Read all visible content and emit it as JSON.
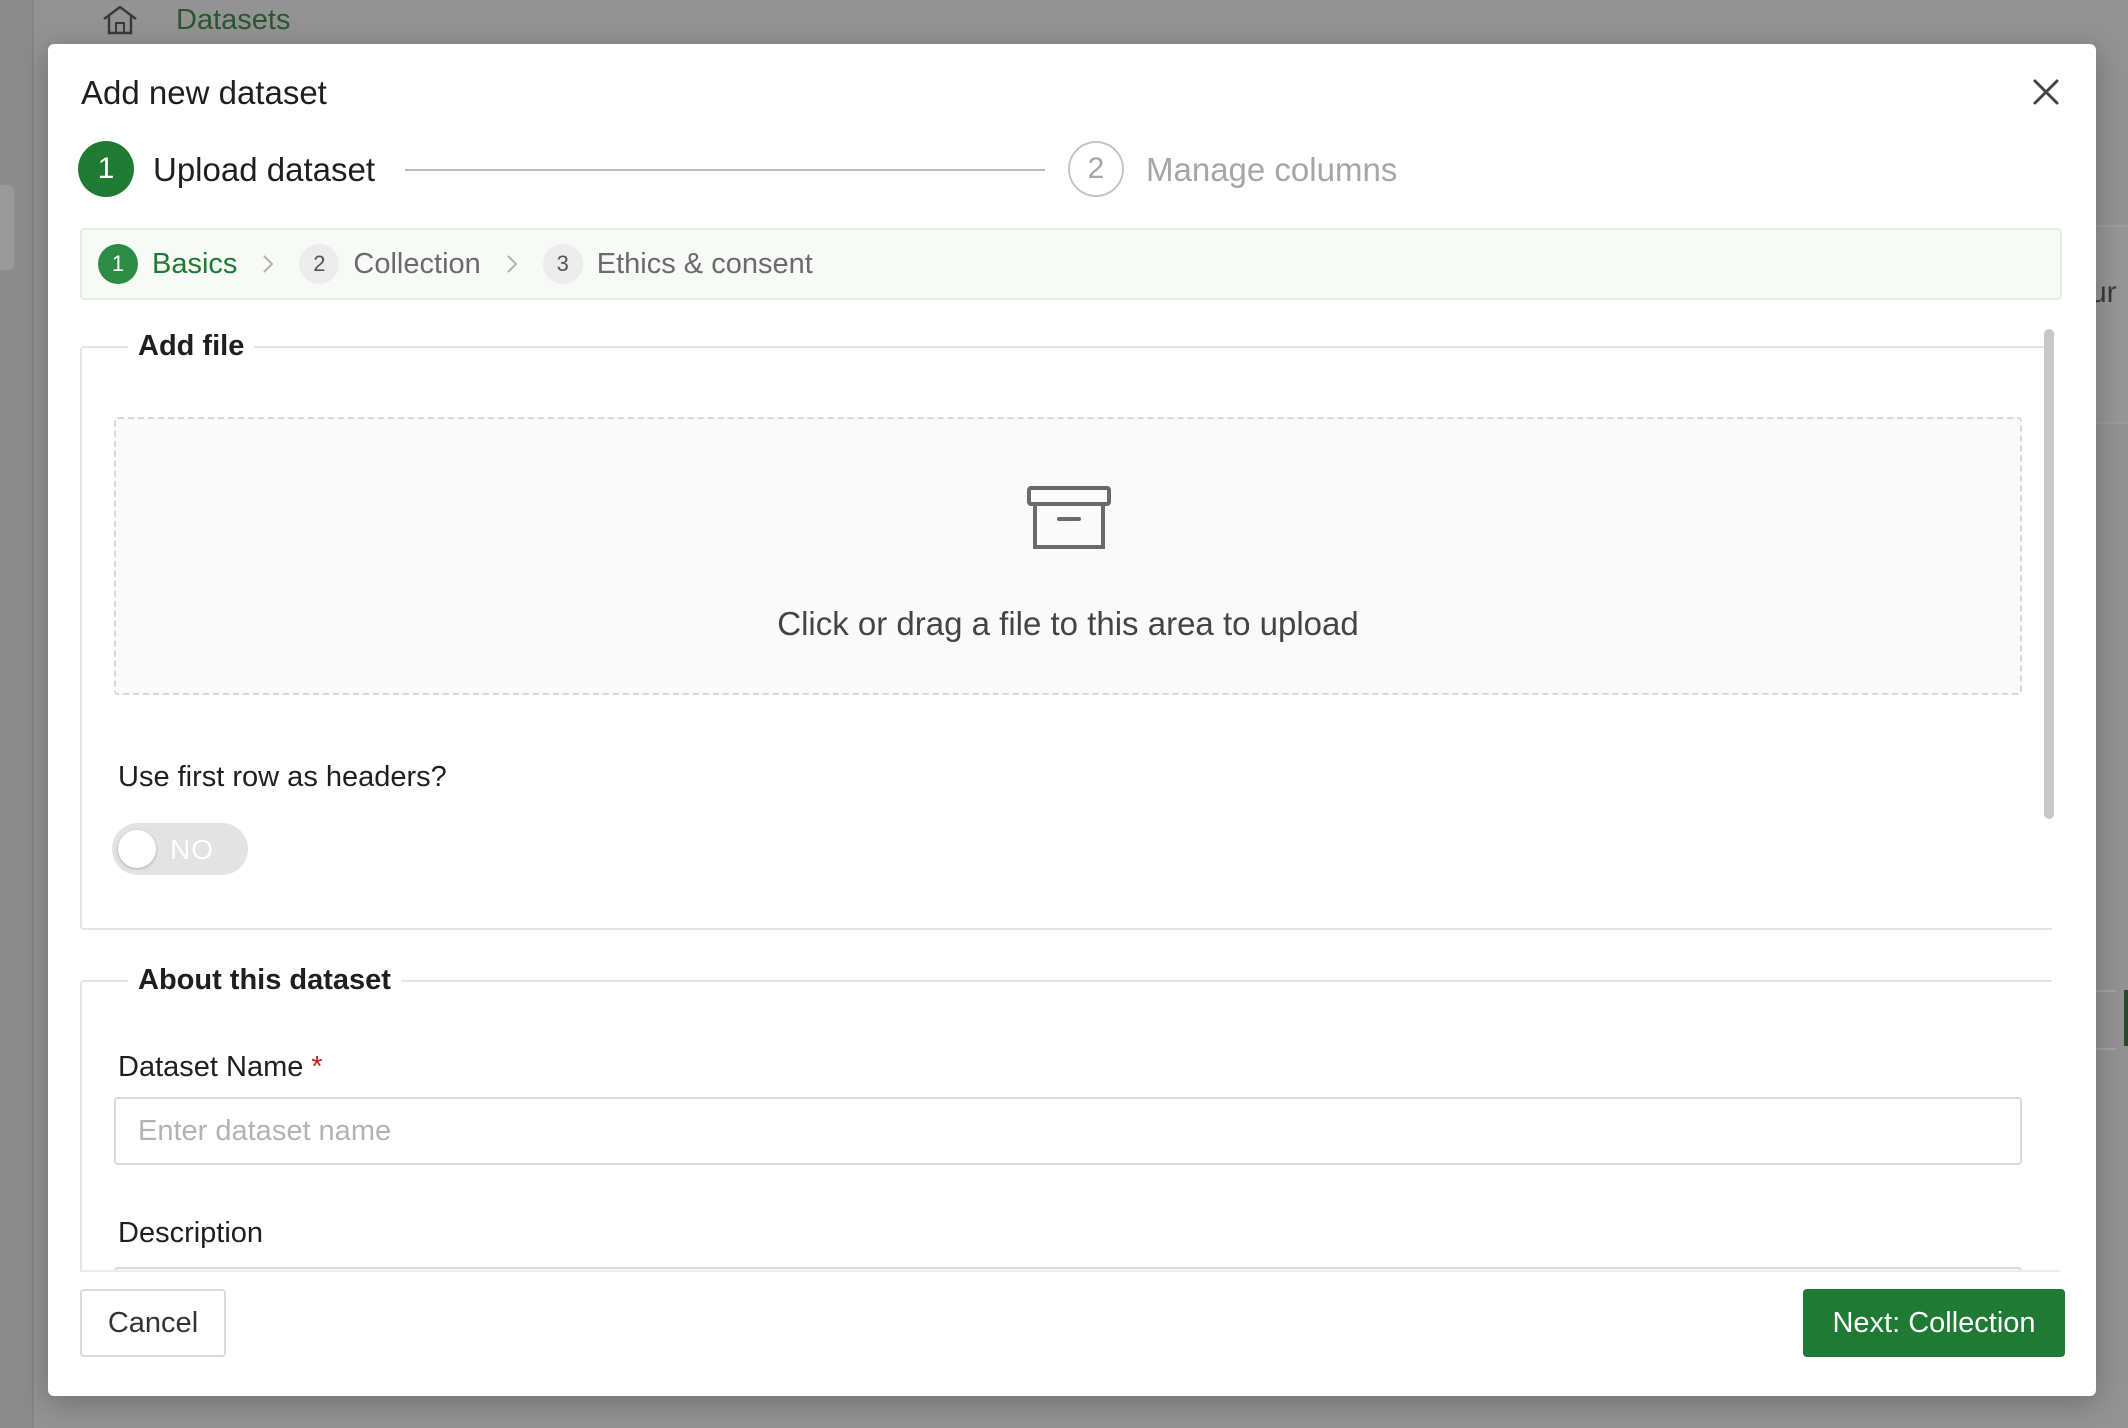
{
  "background": {
    "breadcrumb_label": "Datasets",
    "right_fragment_text": "ur"
  },
  "modal": {
    "title": "Add new dataset",
    "main_steps": [
      {
        "number": "1",
        "label": "Upload dataset",
        "state": "active"
      },
      {
        "number": "2",
        "label": "Manage columns",
        "state": "inactive"
      }
    ],
    "sub_steps": [
      {
        "number": "1",
        "label": "Basics",
        "state": "active"
      },
      {
        "number": "2",
        "label": "Collection",
        "state": "inactive"
      },
      {
        "number": "3",
        "label": "Ethics & consent",
        "state": "inactive"
      }
    ],
    "add_file": {
      "legend": "Add file",
      "upload_text": "Click or drag a file to this area to upload",
      "headers_question": "Use first row as headers?",
      "toggle_value": "NO"
    },
    "about": {
      "legend": "About this dataset",
      "name_label": "Dataset Name",
      "required_mark": "*",
      "name_placeholder": "Enter dataset name",
      "name_value": "",
      "description_label": "Description"
    },
    "footer": {
      "cancel_label": "Cancel",
      "next_label": "Next: Collection"
    }
  },
  "colors": {
    "primary_green": "#1f7a34",
    "active_sub_green": "#2e8b45",
    "required_red": "#c02020",
    "overlay_gray": "#939393"
  },
  "icons": {
    "close": "close-icon",
    "upload": "archive-box-icon",
    "home": "home-icon",
    "sub_step_separator": "chevron-right-icon"
  }
}
